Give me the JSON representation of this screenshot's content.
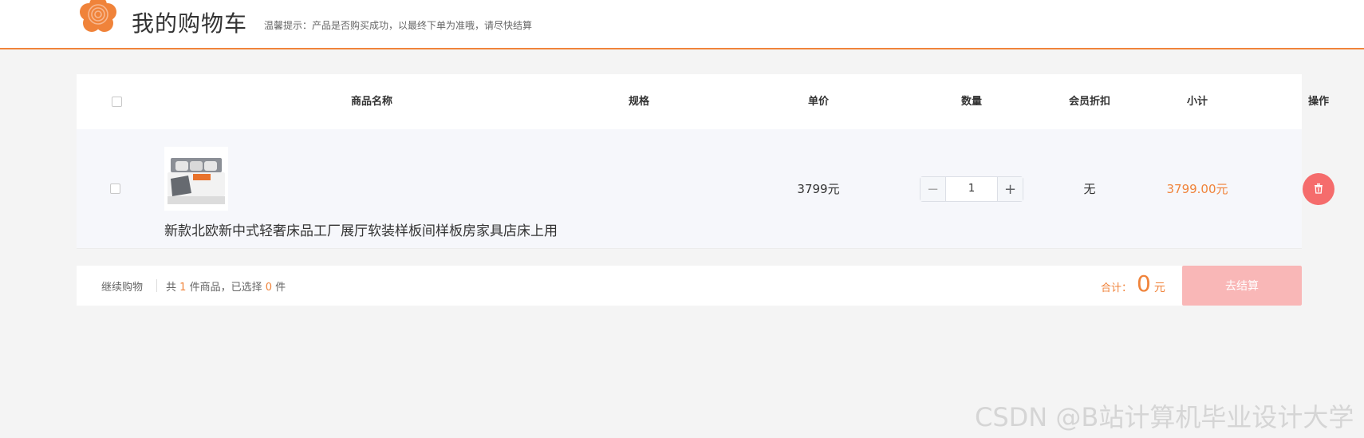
{
  "header": {
    "title": "我的购物车",
    "tip": "温馨提示：产品是否购买成功，以最终下单为准哦，请尽快结算",
    "logo_icon": "flower-logo-icon"
  },
  "table": {
    "columns": [
      "商品名称",
      "规格",
      "单价",
      "数量",
      "会员折扣",
      "小计",
      "操作"
    ],
    "items": [
      {
        "name": "新款北欧新中式轻奢床品工厂展厅软装样板间样板房家具店床上用",
        "spec": "",
        "price": "3799元",
        "quantity": "1",
        "discount": "无",
        "subtotal": "3799.00元"
      }
    ]
  },
  "footer": {
    "continue_label": "继续购物",
    "summary_prefix": "共",
    "total_count": "1",
    "summary_mid": "件商品，已选择",
    "selected_count": "0",
    "summary_suffix": "件",
    "total_label": "合计：",
    "total_value": "0",
    "total_unit": "元",
    "checkout_label": "去结算"
  },
  "watermark": "CSDN @B站计算机毕业设计大学",
  "colors": {
    "accent": "#f0833a",
    "delete": "#f56c6c",
    "checkout_disabled": "#f9b7b7"
  }
}
